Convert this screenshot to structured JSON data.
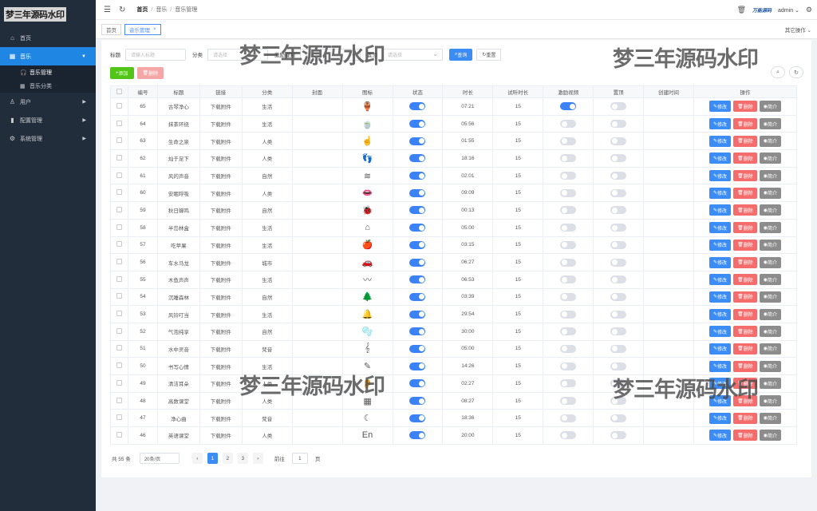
{
  "logo": "梦三年源码水印",
  "sidebar": {
    "items": [
      {
        "label": "首页",
        "icon": "home-icon"
      },
      {
        "label": "音乐",
        "icon": "grid-icon"
      },
      {
        "label": "用户",
        "icon": "user-icon"
      },
      {
        "label": "配置管理",
        "icon": "chart-icon"
      },
      {
        "label": "系统管理",
        "icon": "gear-icon"
      }
    ],
    "sub_items": [
      {
        "label": "音乐管理",
        "icon": "headphones-icon"
      },
      {
        "label": "音乐分类",
        "icon": "grid-icon"
      }
    ]
  },
  "header": {
    "breadcrumb": [
      "首页",
      "音乐",
      "音乐管理"
    ],
    "brand": "万能源码",
    "user": "admin"
  },
  "tabs": {
    "items": [
      "首页",
      "音乐管理"
    ],
    "other_ops": "其它操作"
  },
  "filters": {
    "title_label": "标题",
    "title_placeholder": "请输入标题",
    "category_label": "分类",
    "category_placeholder": "请选择",
    "video_label": "激励视频",
    "video_placeholder": "请选择",
    "top_label": "置顶",
    "top_placeholder": "请选择",
    "search_btn": "查询",
    "reset_btn": "重置"
  },
  "toolbar": {
    "add_btn": "添加",
    "delete_btn": "删除"
  },
  "table": {
    "headers": [
      "编号",
      "标题",
      "链接",
      "分类",
      "封面",
      "图标",
      "状态",
      "时长",
      "试听时长",
      "激励视频",
      "置顶",
      "创建时间",
      "操作"
    ],
    "rows": [
      {
        "id": "65",
        "title": "古琴净心",
        "link": "下载附件",
        "category": "生活",
        "icon": "🏺",
        "status": true,
        "duration": "07:21",
        "trial": "15",
        "video": true,
        "top": false
      },
      {
        "id": "64",
        "title": "抹茶环绕",
        "link": "下载附件",
        "category": "生活",
        "icon": "🍵",
        "status": true,
        "duration": "05:56",
        "trial": "15",
        "video": false,
        "top": false
      },
      {
        "id": "63",
        "title": "生命之泉",
        "link": "下载附件",
        "category": "人类",
        "icon": "☝",
        "status": true,
        "duration": "01:55",
        "trial": "15",
        "video": false,
        "top": false
      },
      {
        "id": "62",
        "title": "灿于足下",
        "link": "下载附件",
        "category": "人类",
        "icon": "👣",
        "status": true,
        "duration": "18:16",
        "trial": "15",
        "video": false,
        "top": false
      },
      {
        "id": "61",
        "title": "风的声音",
        "link": "下载附件",
        "category": "自然",
        "icon": "≋",
        "status": true,
        "duration": "02:01",
        "trial": "15",
        "video": false,
        "top": false
      },
      {
        "id": "60",
        "title": "安眠呼吸",
        "link": "下载附件",
        "category": "人类",
        "icon": "👄",
        "status": true,
        "duration": "09:09",
        "trial": "15",
        "video": false,
        "top": false
      },
      {
        "id": "59",
        "title": "秋日蝉鸣",
        "link": "下载附件",
        "category": "自然",
        "icon": "🐞",
        "status": true,
        "duration": "00:13",
        "trial": "15",
        "video": false,
        "top": false
      },
      {
        "id": "58",
        "title": "半岛林盒",
        "link": "下载附件",
        "category": "生活",
        "icon": "⌂",
        "status": true,
        "duration": "05:00",
        "trial": "15",
        "video": false,
        "top": false
      },
      {
        "id": "57",
        "title": "吃苹果",
        "link": "下载附件",
        "category": "生活",
        "icon": "🍎",
        "status": true,
        "duration": "03:15",
        "trial": "15",
        "video": false,
        "top": false
      },
      {
        "id": "56",
        "title": "车水马龙",
        "link": "下载附件",
        "category": "城市",
        "icon": "🚗",
        "status": true,
        "duration": "06:27",
        "trial": "15",
        "video": false,
        "top": false
      },
      {
        "id": "55",
        "title": "木鱼声声",
        "link": "下载附件",
        "category": "生活",
        "icon": "〰",
        "status": true,
        "duration": "06:53",
        "trial": "15",
        "video": false,
        "top": false
      },
      {
        "id": "54",
        "title": "沉睡森林",
        "link": "下载附件",
        "category": "自然",
        "icon": "🌲",
        "status": true,
        "duration": "03:39",
        "trial": "15",
        "video": false,
        "top": false
      },
      {
        "id": "53",
        "title": "风铃叮当",
        "link": "下载附件",
        "category": "生活",
        "icon": "🔔",
        "status": true,
        "duration": "29:54",
        "trial": "15",
        "video": false,
        "top": false
      },
      {
        "id": "52",
        "title": "气泡纯享",
        "link": "下载附件",
        "category": "自然",
        "icon": "🫧",
        "status": true,
        "duration": "30:00",
        "trial": "15",
        "video": false,
        "top": false
      },
      {
        "id": "51",
        "title": "水中灵音",
        "link": "下载附件",
        "category": "梵音",
        "icon": "𝄞",
        "status": true,
        "duration": "05:00",
        "trial": "15",
        "video": false,
        "top": false
      },
      {
        "id": "50",
        "title": "书写心情",
        "link": "下载附件",
        "category": "生活",
        "icon": "✎",
        "status": true,
        "duration": "14:26",
        "trial": "15",
        "video": false,
        "top": false
      },
      {
        "id": "49",
        "title": "清洁耳朵",
        "link": "下载附件",
        "category": "人类",
        "icon": "👂",
        "status": true,
        "duration": "02:27",
        "trial": "15",
        "video": false,
        "top": false
      },
      {
        "id": "48",
        "title": "高数课堂",
        "link": "下载附件",
        "category": "人类",
        "icon": "▦",
        "status": true,
        "duration": "08:27",
        "trial": "15",
        "video": false,
        "top": false
      },
      {
        "id": "47",
        "title": "净心曲",
        "link": "下载附件",
        "category": "梵音",
        "icon": "☾",
        "status": true,
        "duration": "18:36",
        "trial": "15",
        "video": false,
        "top": false
      },
      {
        "id": "46",
        "title": "英语课堂",
        "link": "下载附件",
        "category": "人类",
        "icon": "En",
        "status": true,
        "duration": "20:00",
        "trial": "15",
        "video": false,
        "top": false
      }
    ],
    "op_edit": "修改",
    "op_delete": "删除",
    "op_view": "简介"
  },
  "pager": {
    "total": "共 55 条",
    "page_size": "20条/页",
    "pages": [
      "1",
      "2",
      "3"
    ],
    "current": "1",
    "goto_label": "前往",
    "goto_value": "1",
    "goto_suffix": "页"
  },
  "watermark": "梦三年源码水印",
  "colors": {
    "primary": "#3b8cf4",
    "danger": "#f56c6c",
    "sidebar": "#222d3b",
    "success": "#52c41a"
  }
}
